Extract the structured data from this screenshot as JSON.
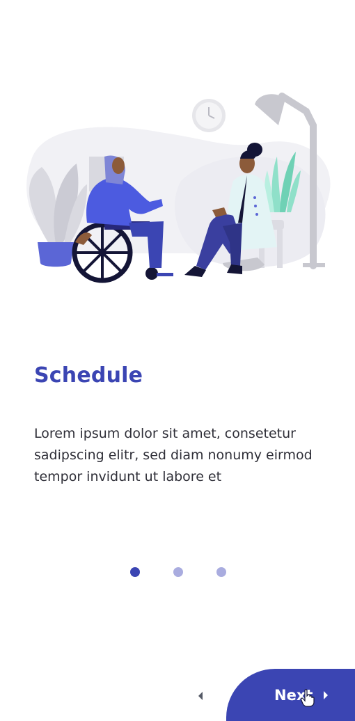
{
  "screen": {
    "title": "Schedule",
    "description": "Lorem ipsum dolor sit amet, consetetur sadipscing elitr, sed diam nonumy eirmod tempor invidunt ut labore et",
    "illustration_icon": "doctor-consultation-illustration"
  },
  "pager": {
    "current": 1,
    "total": 3
  },
  "navigation": {
    "prev_icon": "chevron-left-icon",
    "next_label": "Next",
    "next_icon": "chevron-right-icon"
  },
  "colors": {
    "primary": "#3b45b3",
    "dot_inactive": "#a9acdf",
    "text": "#2f2f38"
  }
}
